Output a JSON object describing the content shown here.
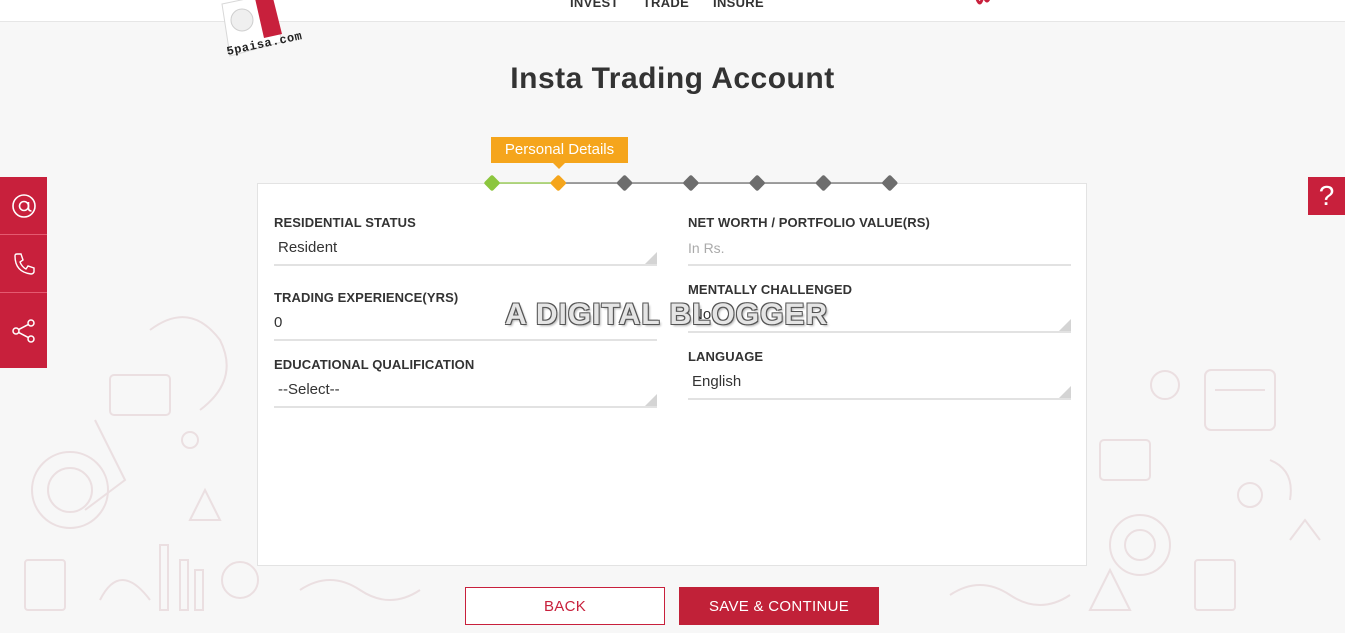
{
  "nav": {
    "items": [
      "INVEST",
      "TRADE",
      "INSURE"
    ]
  },
  "logo": {
    "text": "5paisa.com"
  },
  "page": {
    "title": "Insta Trading Account"
  },
  "stepper": {
    "active_label": "Personal Details",
    "steps": [
      {
        "status": "done",
        "color": "#8cc63e"
      },
      {
        "status": "active",
        "color": "#f5a51c"
      },
      {
        "status": "pending",
        "color": "#6d6d6d"
      },
      {
        "status": "pending",
        "color": "#6d6d6d"
      },
      {
        "status": "pending",
        "color": "#6d6d6d"
      },
      {
        "status": "pending",
        "color": "#6d6d6d"
      },
      {
        "status": "pending",
        "color": "#6d6d6d"
      }
    ]
  },
  "sidebar": {
    "icons": [
      "at-icon",
      "phone-icon",
      "share-icon"
    ],
    "help": "?"
  },
  "form": {
    "residential_status": {
      "label": "RESIDENTIAL STATUS",
      "value": "Resident"
    },
    "trading_experience": {
      "label": "TRADING EXPERIENCE(YRS)",
      "value": "0"
    },
    "educational_qualification": {
      "label": "EDUCATIONAL QUALIFICATION",
      "value": "--Select--"
    },
    "net_worth": {
      "label": "NET WORTH / PORTFOLIO VALUE(RS)",
      "placeholder": "In Rs."
    },
    "mentally_challenged": {
      "label": "MENTALLY CHALLENGED",
      "value": "No"
    },
    "language": {
      "label": "LANGUAGE",
      "value": "English"
    }
  },
  "watermark": "A DIGITAL BLOGGER",
  "buttons": {
    "back": "BACK",
    "save": "SAVE & CONTINUE"
  },
  "colors": {
    "brand": "#c8203c",
    "step_active": "#f5a51c",
    "step_done": "#8cc63e",
    "step_pending": "#6d6d6d"
  }
}
